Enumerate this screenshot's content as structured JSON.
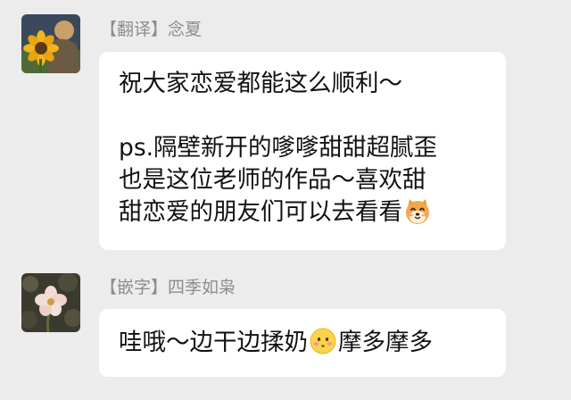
{
  "messages": [
    {
      "sender": "【翻译】念夏",
      "avatar_icon": "sunflower-avatar-icon",
      "lines": [
        "祝大家恋爱都能这么顺利～",
        "",
        "ps.隔壁新开的嗲嗲甜甜超腻歪",
        "也是这位老师的作品～喜欢甜",
        "甜恋爱的朋友们可以去看看"
      ],
      "trailing_emoji": "shiba-dog-emoji-icon"
    },
    {
      "sender": "【嵌字】四季如枭",
      "avatar_icon": "flower-photo-avatar-icon",
      "text_before_emoji": "哇哦～边干边揉奶",
      "inline_emoji": "blushing-face-emoji-icon",
      "text_after_emoji": "摩多摩多"
    }
  ],
  "colors": {
    "background": "#ececec",
    "bubble": "#ffffff",
    "sender_name": "#8d8d8d",
    "text": "#111111"
  }
}
